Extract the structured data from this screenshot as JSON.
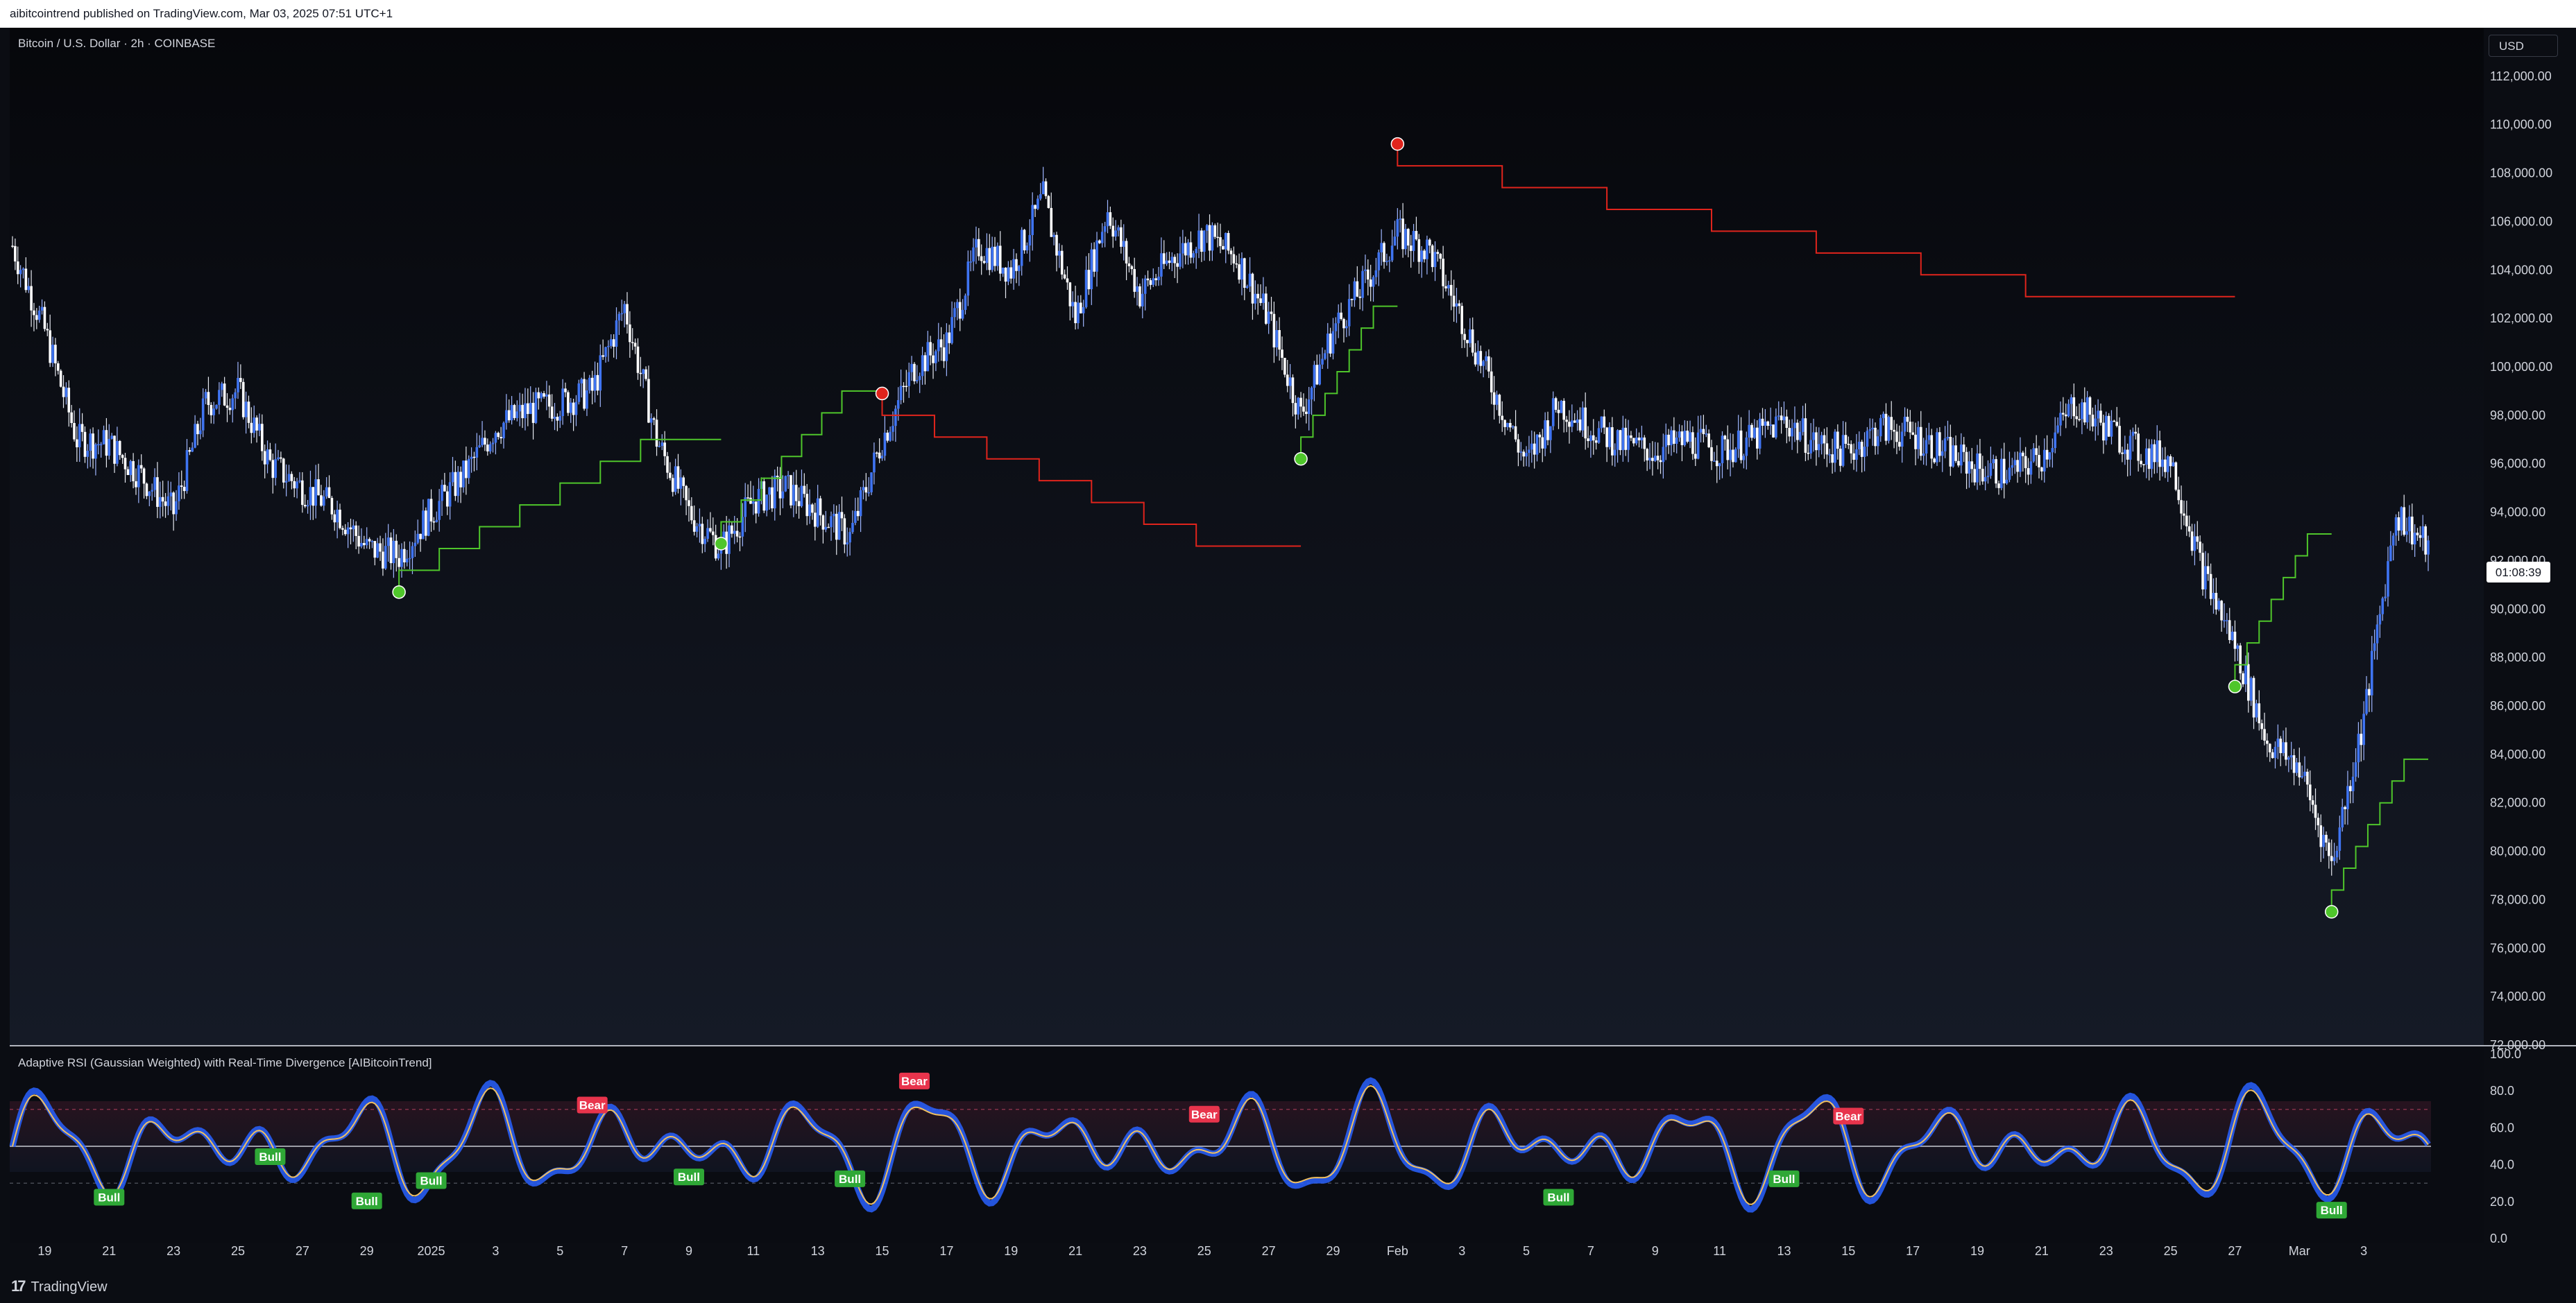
{
  "header": {
    "publisher_line": "aibitcointrend published on TradingView.com, Mar 03, 2025 07:51 UTC+1"
  },
  "main_pane": {
    "symbol_title": "Bitcoin / U.S. Dollar · 2h · COINBASE",
    "currency_button": "USD",
    "countdown": "01:08:39"
  },
  "indicator_pane": {
    "title": "Adaptive RSI (Gaussian Weighted) with Real-Time Divergence [AIBitcoinTrend]"
  },
  "footer": {
    "brand": "TradingView"
  },
  "colors": {
    "background": "#0b0d13",
    "candle": "#3f74f2",
    "trail_green": "#4fc62b",
    "trail_red": "#e0241c",
    "bull_label": "#2fa836",
    "bear_label": "#e8344c",
    "rsi_line": "#f0c060",
    "rsi_band": "#2962ff"
  },
  "chart_data": [
    {
      "type": "candlestick",
      "title": "Bitcoin / U.S. Dollar · 2h · COINBASE",
      "ylim": [
        72000,
        114000
      ],
      "y_ticks": [
        "72,000.00",
        "74,000.00",
        "76,000.00",
        "78,000.00",
        "80,000.00",
        "82,000.00",
        "84,000.00",
        "86,000.00",
        "88,000.00",
        "90,000.00",
        "92,000.00",
        "94,000.00",
        "96,000.00",
        "98,000.00",
        "100,000.00",
        "102,000.00",
        "104,000.00",
        "106,000.00",
        "108,000.00",
        "110,000.00",
        "112,000.00"
      ],
      "x_ticks": [
        "19",
        "21",
        "23",
        "25",
        "27",
        "29",
        "2025",
        "3",
        "5",
        "7",
        "9",
        "11",
        "13",
        "15",
        "17",
        "19",
        "21",
        "23",
        "25",
        "27",
        "29",
        "Feb",
        "3",
        "5",
        "7",
        "9",
        "11",
        "13",
        "15",
        "17",
        "19",
        "21",
        "23",
        "25",
        "27",
        "Mar",
        "3"
      ],
      "price_path": {
        "x": [
          "Dec 18",
          "Dec 19",
          "Dec 20",
          "Dec 21",
          "Dec 22",
          "Dec 23",
          "Dec 24",
          "Dec 25",
          "Dec 26",
          "Dec 27",
          "Dec 28",
          "Dec 29",
          "Dec 30",
          "Dec 31",
          "Jan 1",
          "Jan 2",
          "Jan 3",
          "Jan 4",
          "Jan 5",
          "Jan 6",
          "Jan 7",
          "Jan 8",
          "Jan 9",
          "Jan 10",
          "Jan 11",
          "Jan 12",
          "Jan 13",
          "Jan 14",
          "Jan 15",
          "Jan 16",
          "Jan 17",
          "Jan 18",
          "Jan 19",
          "Jan 20",
          "Jan 21",
          "Jan 22",
          "Jan 23",
          "Jan 24",
          "Jan 25",
          "Jan 26",
          "Jan 27",
          "Jan 28",
          "Jan 29",
          "Jan 30",
          "Jan 31",
          "Feb 1",
          "Feb 2",
          "Feb 3",
          "Feb 4",
          "Feb 5",
          "Feb 6",
          "Feb 7",
          "Feb 8",
          "Feb 9",
          "Feb 10",
          "Feb 11",
          "Feb 12",
          "Feb 13",
          "Feb 14",
          "Feb 15",
          "Feb 16",
          "Feb 17",
          "Feb 18",
          "Feb 19",
          "Feb 20",
          "Feb 21",
          "Feb 22",
          "Feb 23",
          "Feb 24",
          "Feb 25",
          "Feb 26",
          "Feb 27",
          "Feb 28",
          "Mar 1",
          "Mar 2",
          "Mar 3"
        ],
        "y": [
          105000,
          101500,
          97000,
          96800,
          95500,
          94000,
          98500,
          99000,
          96000,
          95000,
          94200,
          92500,
          92200,
          94000,
          95500,
          97500,
          98200,
          98500,
          99000,
          102500,
          97000,
          94000,
          92500,
          94500,
          95000,
          94000,
          93000,
          97000,
          100000,
          101000,
          105000,
          104000,
          107000,
          102000,
          106500,
          103000,
          104500,
          105500,
          104500,
          102000,
          98000,
          101500,
          103500,
          105500,
          104800,
          102000,
          99000,
          96000,
          98500,
          97500,
          96800,
          96500,
          97000,
          96500,
          97000,
          97800,
          96800,
          96500,
          97500,
          97200,
          96500,
          95800,
          95600,
          96300,
          98500,
          97500,
          96500,
          96200,
          91500,
          88500,
          84500,
          83500,
          79500,
          85500,
          94000,
          92500
        ]
      },
      "trailing_stop_markers": [
        {
          "x": "Dec 30",
          "y": 90700,
          "side": "bull"
        },
        {
          "x": "Jan 9",
          "y": 92700,
          "side": "bull"
        },
        {
          "x": "Jan 14",
          "y": 98900,
          "side": "bear"
        },
        {
          "x": "Jan 27",
          "y": 96200,
          "side": "bull"
        },
        {
          "x": "Jan 30",
          "y": 109200,
          "side": "bear"
        },
        {
          "x": "Feb 25",
          "y": 86800,
          "side": "bull"
        },
        {
          "x": "Feb 28",
          "y": 77500,
          "side": "bull"
        }
      ]
    },
    {
      "type": "line",
      "title": "Adaptive RSI (Gaussian Weighted) with Real-Time Divergence [AIBitcoinTrend]",
      "ylim": [
        0,
        100
      ],
      "y_ticks": [
        "0.0",
        "20.0",
        "40.0",
        "60.0",
        "80.0",
        "100.0"
      ],
      "levels": [
        30,
        50,
        70
      ],
      "divergence_labels": [
        {
          "x": "Dec 21",
          "y": 22,
          "text": "Bull"
        },
        {
          "x": "Dec 26",
          "y": 44,
          "text": "Bull"
        },
        {
          "x": "Dec 29",
          "y": 20,
          "text": "Bull"
        },
        {
          "x": "Dec 31",
          "y": 31,
          "text": "Bull"
        },
        {
          "x": "Jan 5",
          "y": 72,
          "text": "Bear"
        },
        {
          "x": "Jan 8",
          "y": 33,
          "text": "Bull"
        },
        {
          "x": "Jan 13",
          "y": 32,
          "text": "Bull"
        },
        {
          "x": "Jan 15",
          "y": 85,
          "text": "Bear"
        },
        {
          "x": "Jan 24",
          "y": 67,
          "text": "Bear"
        },
        {
          "x": "Feb 4",
          "y": 22,
          "text": "Bull"
        },
        {
          "x": "Feb 11",
          "y": 32,
          "text": "Bull"
        },
        {
          "x": "Feb 13",
          "y": 66,
          "text": "Bear"
        },
        {
          "x": "Feb 28",
          "y": 15,
          "text": "Bull"
        }
      ]
    }
  ]
}
